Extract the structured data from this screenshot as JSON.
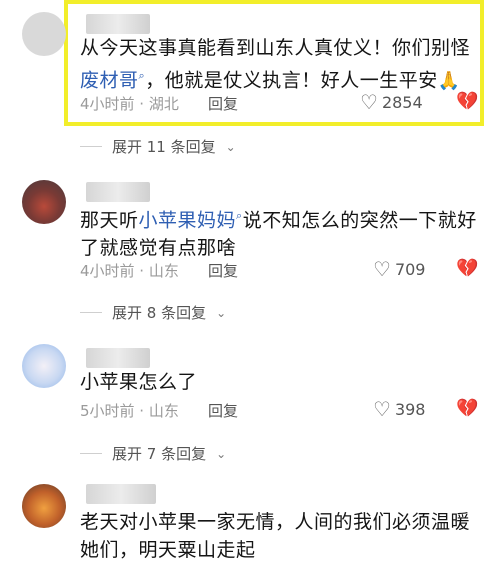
{
  "comments": [
    {
      "text_part1": "从今天这事真能看到山东人真仗义！你们别怪",
      "mention": "废材哥",
      "text_part2": "，他就是仗义执言！好人一生平安",
      "emoji": "🙏",
      "time_location": "4小时前 · 湖北",
      "reply": "回复",
      "likes": "2854",
      "expand": "展开 11 条回复"
    },
    {
      "text_part1": "那天听",
      "mention": "小苹果妈妈",
      "text_part2": "说不知怎么的突然一下就好了就感觉有点那啥",
      "time_location": "4小时前 · 山东",
      "reply": "回复",
      "likes": "709",
      "expand": "展开 8 条回复"
    },
    {
      "text": "小苹果怎么了",
      "time_location": "5小时前 · 山东",
      "reply": "回复",
      "likes": "398",
      "expand": "展开 7 条回复"
    },
    {
      "text": "老天对小苹果一家无情，人间的我们必须温暖她们，明天粟山走起"
    }
  ],
  "icons": {
    "like": "heart-outline-icon",
    "dislike": "broken-heart-icon",
    "expand": "chevron-down-icon",
    "mention": "search-icon"
  },
  "colors": {
    "highlight": "#f2ee2a",
    "link": "#2f5fb3"
  }
}
